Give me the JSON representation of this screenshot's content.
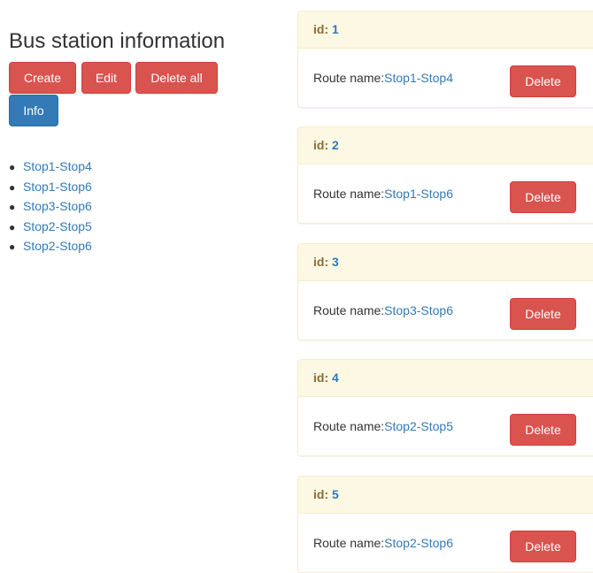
{
  "page": {
    "title": "Bus station information"
  },
  "toolbar": {
    "create_label": "Create",
    "edit_label": "Edit",
    "delete_all_label": "Delete all",
    "info_label": "Info"
  },
  "routes_list": [
    "Stop1-Stop4",
    "Stop1-Stop6",
    "Stop3-Stop6",
    "Stop2-Stop5",
    "Stop2-Stop6"
  ],
  "panels": [
    {
      "id_label": "id:",
      "id_value": "1",
      "route_label": "Route name:",
      "route_name": "Stop1-Stop4",
      "delete_label": "Delete"
    },
    {
      "id_label": "id:",
      "id_value": "2",
      "route_label": "Route name:",
      "route_name": "Stop1-Stop6",
      "delete_label": "Delete"
    },
    {
      "id_label": "id:",
      "id_value": "3",
      "route_label": "Route name:",
      "route_name": "Stop3-Stop6",
      "delete_label": "Delete"
    },
    {
      "id_label": "id:",
      "id_value": "4",
      "route_label": "Route name:",
      "route_name": "Stop2-Stop5",
      "delete_label": "Delete"
    },
    {
      "id_label": "id:",
      "id_value": "5",
      "route_label": "Route name:",
      "route_name": "Stop2-Stop6",
      "delete_label": "Delete"
    }
  ],
  "colors": {
    "danger": "#d9534f",
    "primary": "#337ab7",
    "panel_heading_bg": "#fcf8e3",
    "panel_heading_text": "#8a6d3b"
  }
}
